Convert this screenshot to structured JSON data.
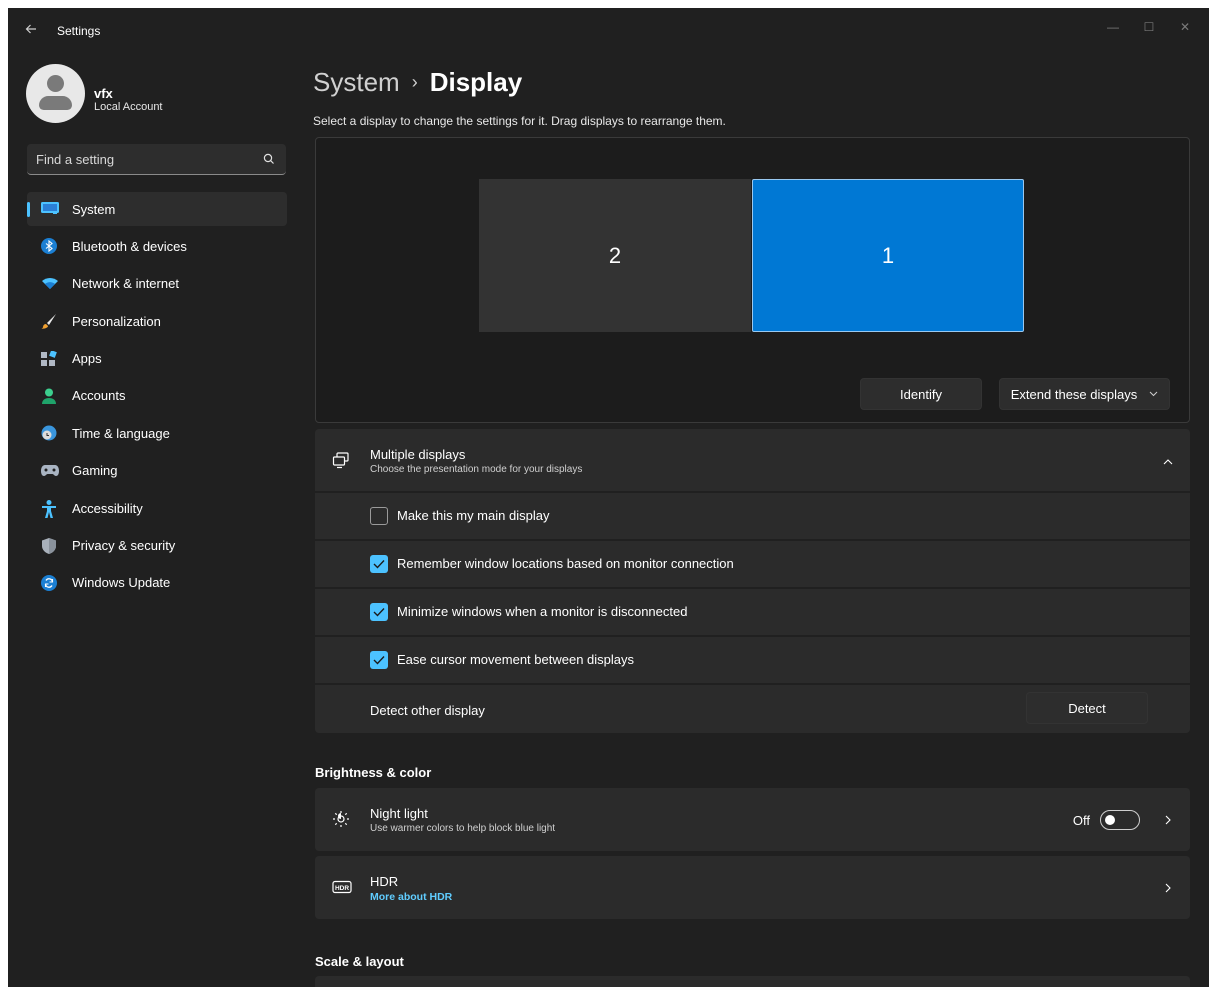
{
  "window": {
    "title": "Settings",
    "back_icon": "back-arrow-icon",
    "controls": {
      "minimize": "—",
      "maximize": "☐",
      "close": "✕"
    }
  },
  "profile": {
    "name": "vfx",
    "account_type": "Local Account"
  },
  "search": {
    "placeholder": "Find a setting"
  },
  "nav": {
    "items": [
      {
        "label": "System",
        "icon": "system-icon",
        "active": true
      },
      {
        "label": "Bluetooth & devices",
        "icon": "bluetooth-icon"
      },
      {
        "label": "Network & internet",
        "icon": "wifi-icon"
      },
      {
        "label": "Personalization",
        "icon": "brush-icon"
      },
      {
        "label": "Apps",
        "icon": "apps-icon"
      },
      {
        "label": "Accounts",
        "icon": "accounts-icon"
      },
      {
        "label": "Time & language",
        "icon": "globe-clock-icon"
      },
      {
        "label": "Gaming",
        "icon": "gamepad-icon"
      },
      {
        "label": "Accessibility",
        "icon": "accessibility-icon"
      },
      {
        "label": "Privacy & security",
        "icon": "shield-icon"
      },
      {
        "label": "Windows Update",
        "icon": "update-icon"
      }
    ]
  },
  "breadcrumb": {
    "parent": "System",
    "separator": "›",
    "current": "Display"
  },
  "arrange": {
    "instruction": "Select a display to change the settings for it. Drag displays to rearrange them.",
    "monitors": [
      {
        "number": "2",
        "selected": false
      },
      {
        "number": "1",
        "selected": true
      }
    ],
    "identify_label": "Identify",
    "extend_label": "Extend these displays"
  },
  "multiple_displays": {
    "title": "Multiple displays",
    "description": "Choose the presentation mode for your displays",
    "expanded": true,
    "options": [
      {
        "label": "Make this my main display",
        "checked": false
      },
      {
        "label": "Remember window locations based on monitor connection",
        "checked": true
      },
      {
        "label": "Minimize windows when a monitor is disconnected",
        "checked": true
      },
      {
        "label": "Ease cursor movement between displays",
        "checked": true
      }
    ],
    "detect_label": "Detect other display",
    "detect_button": "Detect"
  },
  "brightness": {
    "section_title": "Brightness & color",
    "night_light": {
      "title": "Night light",
      "description": "Use warmer colors to help block blue light",
      "state_label": "Off",
      "on": false
    },
    "hdr": {
      "title": "HDR",
      "link": "More about HDR"
    }
  },
  "scale": {
    "section_title": "Scale & layout"
  },
  "colors": {
    "accent": "#4cc2ff",
    "selected_monitor": "#0078d4",
    "background": "#202020",
    "card": "#2b2b2b",
    "link": "#60cdff"
  }
}
